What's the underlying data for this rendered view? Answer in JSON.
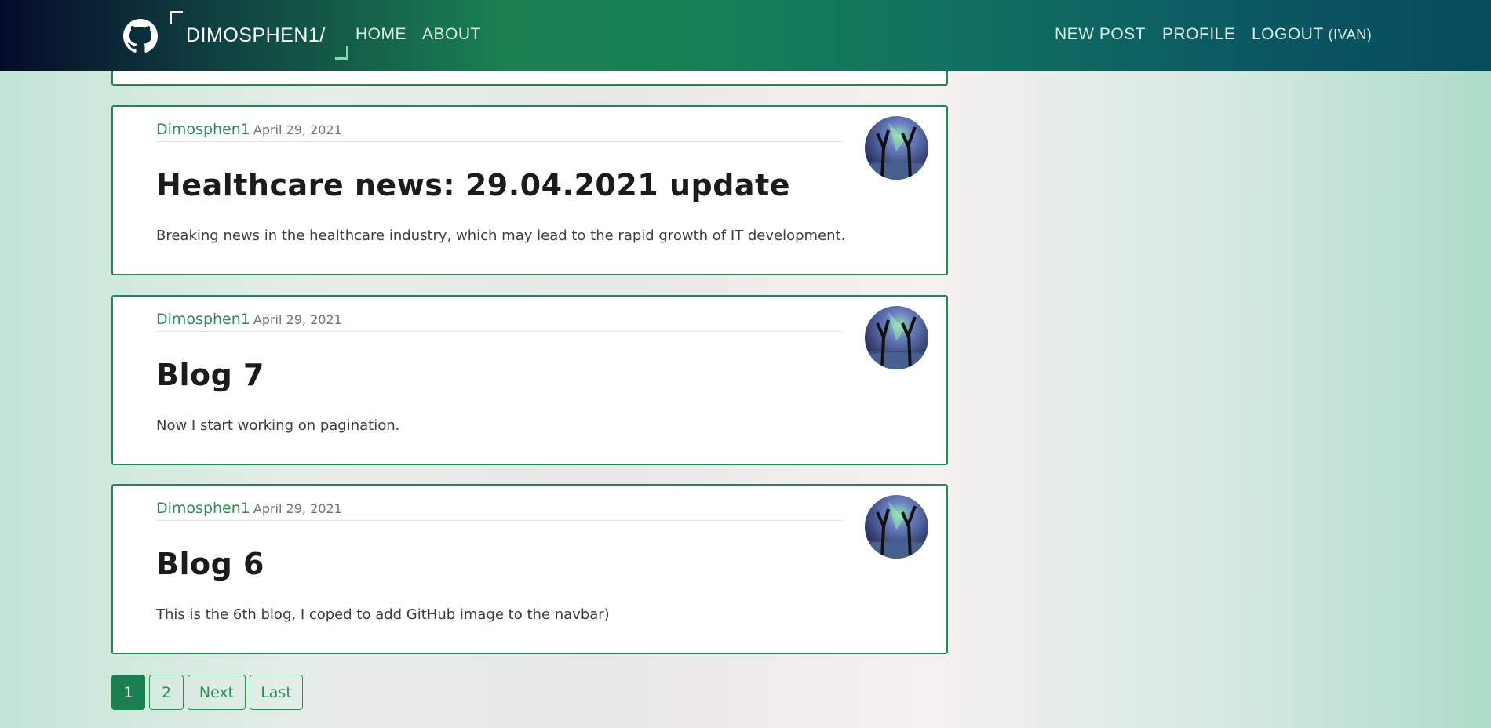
{
  "navbar": {
    "brand": "DIMOSPHEN1/",
    "links_left": [
      "HOME",
      "ABOUT"
    ],
    "new_post": "NEW POST",
    "profile": "PROFILE",
    "logout": "LOGOUT",
    "logout_user": "(IVAN)",
    "icon": "github-icon"
  },
  "posts": [
    {
      "author": "Dimosphen1",
      "date": "April 29, 2021",
      "title": "Healthcare news: 29.04.2021 update",
      "content": "Breaking news in the healthcare industry, which may lead to the rapid growth of IT development."
    },
    {
      "author": "Dimosphen1",
      "date": "April 29, 2021",
      "title": "Blog 7",
      "content": "Now I start working on pagination."
    },
    {
      "author": "Dimosphen1",
      "date": "April 29, 2021",
      "title": "Blog 6",
      "content": "This is the 6th blog, I coped to add GitHub image to the navbar)"
    }
  ],
  "pagination": {
    "pages": [
      "1",
      "2"
    ],
    "active": "1",
    "next": "Next",
    "last": "Last"
  },
  "colors": {
    "accent": "#2e8b57",
    "active_page": "#1a8050",
    "card_border": "#1c8a53"
  }
}
